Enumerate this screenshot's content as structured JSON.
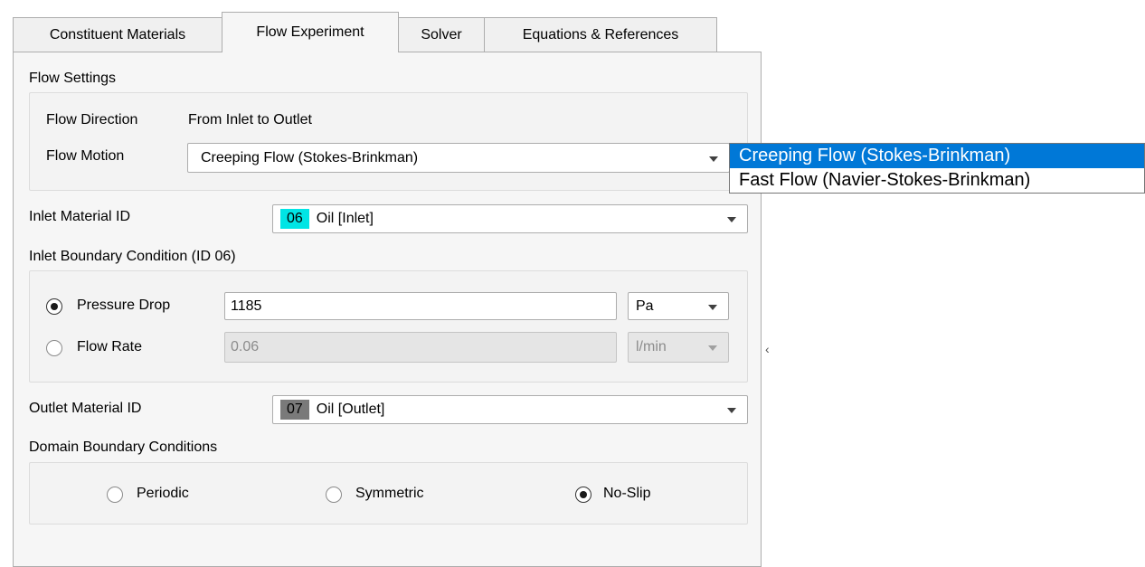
{
  "tabs": [
    "Constituent Materials",
    "Flow Experiment",
    "Solver",
    "Equations & References"
  ],
  "flow_settings": {
    "title": "Flow Settings",
    "direction_label": "Flow Direction",
    "direction_value": "From Inlet to Outlet",
    "motion_label": "Flow Motion",
    "motion_value": "Creeping Flow (Stokes-Brinkman)"
  },
  "inlet": {
    "label": "Inlet Material ID",
    "id": "06",
    "name": "Oil [Inlet]",
    "chip_color": "#00e5e5"
  },
  "inlet_bc": {
    "title": "Inlet Boundary Condition (ID 06)",
    "pressure_label": "Pressure Drop",
    "pressure_value": "1185",
    "pressure_unit": "Pa",
    "flow_label": "Flow Rate",
    "flow_value": "0.06",
    "flow_unit": "l/min"
  },
  "outlet": {
    "label": "Outlet Material ID",
    "id": "07",
    "name": "Oil [Outlet]",
    "chip_color": "#7a7a7a"
  },
  "domain_bc": {
    "title": "Domain Boundary Conditions",
    "options": [
      "Periodic",
      "Symmetric",
      "No-Slip"
    ],
    "selected": "No-Slip"
  },
  "dropdown_popup": {
    "options": [
      "Creeping Flow (Stokes-Brinkman)",
      "Fast Flow (Navier-Stokes-Brinkman)"
    ],
    "highlighted": "Creeping Flow (Stokes-Brinkman)"
  },
  "splitter_glyph": "‹",
  "colors": {
    "selection": "#0078d7",
    "panel_bg": "#f6f6f6"
  }
}
